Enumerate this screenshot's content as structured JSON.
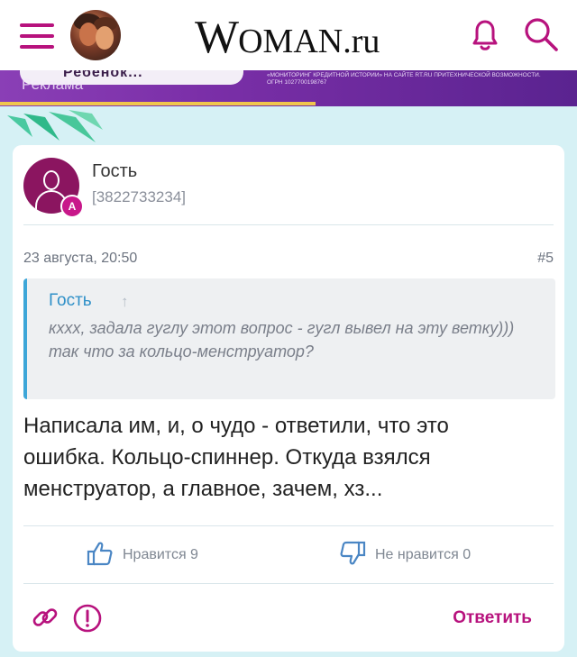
{
  "header": {
    "logo_big": "W",
    "logo_mid": "OMAN",
    "logo_ru": ".ru"
  },
  "ad": {
    "pill_text": "Ребенок...",
    "label": "Реклама",
    "fine_print": "«Мониторинг кредитной истории» на сайте rt.ru Притехнической возможности. ОГРН 1027700198767"
  },
  "post": {
    "author": "Гость",
    "author_id": "[3822733234]",
    "badge": "A",
    "date": "23 августа, 20:50",
    "number": "#5",
    "quote": {
      "author": "Гость",
      "arrow": "↑",
      "line1": "кххх, задала гуглу этот вопрос - гугл вывел на эту ветку)))",
      "line2": "так что за кольцо-менструатор?"
    },
    "text": "Написала им, и, о чудо - ответили, что это ошибка. Кольцо-спиннер. Откуда взялся менструатор, а главное, зачем, хз..."
  },
  "reactions": {
    "like_label": "Нравится 9",
    "dislike_label": "Не нравится 0"
  },
  "actions": {
    "reply_label": "Ответить"
  },
  "colors": {
    "brand": "#b7127d",
    "quote_author": "#2f90c8",
    "background": "#d6f1f5"
  }
}
